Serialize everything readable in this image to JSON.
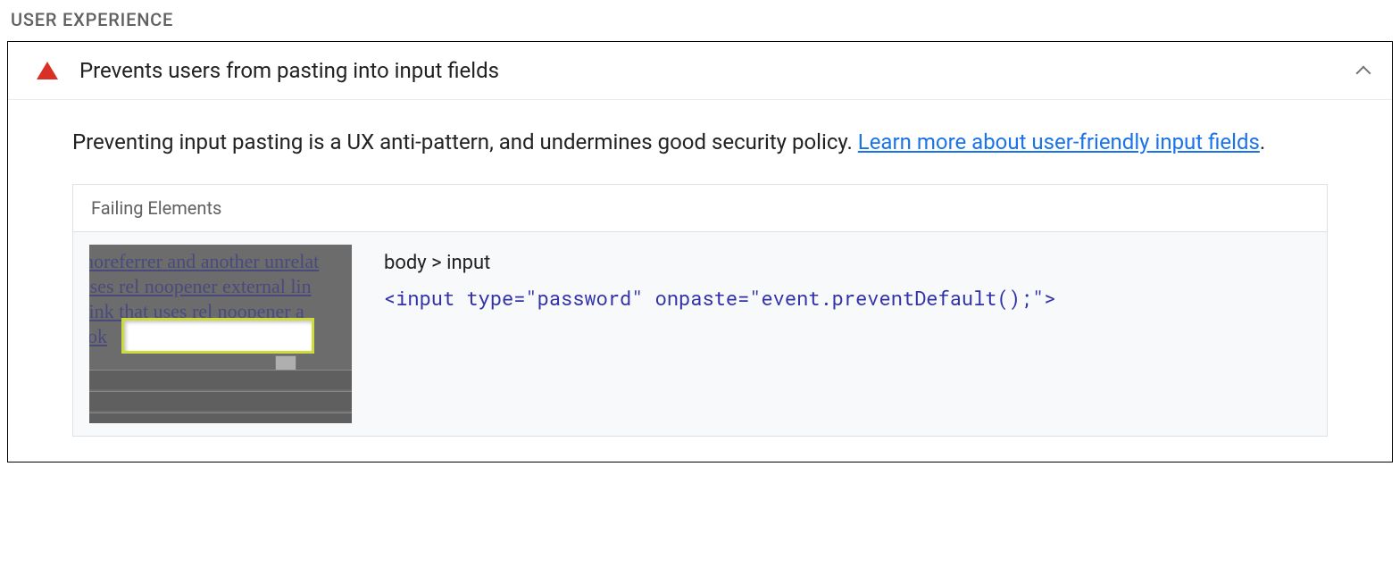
{
  "section": {
    "title": "USER EXPERIENCE"
  },
  "audit": {
    "title": "Prevents users from pasting into input fields",
    "description_pre": "Preventing input pasting is a UX anti-pattern, and undermines good security policy. ",
    "learn_more_text": "Learn more about user-friendly input fields",
    "description_post": ".",
    "failing_header": "Failing Elements",
    "failing": {
      "selector": "body > input",
      "snippet": "<input type=\"password\" onpaste=\"event.preventDefault();\">"
    },
    "thumbnail": {
      "line1": " noreferrer and another unrelat",
      "line2": "t uses rel noopener external lin",
      "line3": "al link that uses rel noopener a",
      "line4": " ok"
    }
  }
}
